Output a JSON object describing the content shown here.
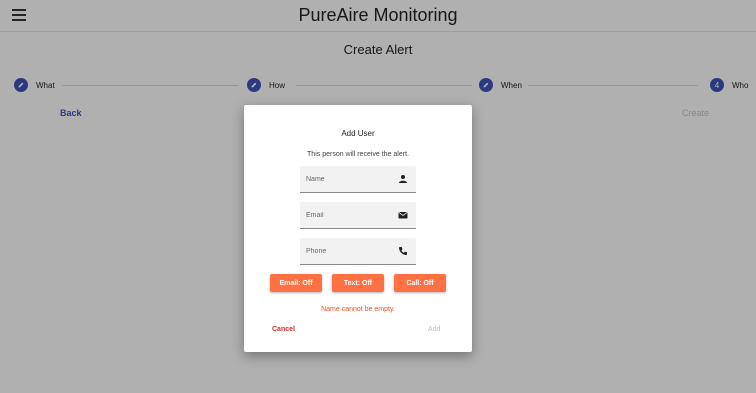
{
  "header": {
    "title": "PureAire Monitoring"
  },
  "page": {
    "title": "Create Alert"
  },
  "stepper": {
    "steps": [
      {
        "label": "What",
        "state": "done"
      },
      {
        "label": "How",
        "state": "done"
      },
      {
        "label": "When",
        "state": "done"
      },
      {
        "label": "Who",
        "state": "active",
        "number": "4"
      }
    ]
  },
  "nav": {
    "back_label": "Back",
    "create_label": "Create"
  },
  "dialog": {
    "title": "Add User",
    "subtitle": "This person will receive the alert.",
    "fields": {
      "name": {
        "placeholder": "Name",
        "value": "",
        "icon": "person-icon"
      },
      "email": {
        "placeholder": "Email",
        "value": "",
        "icon": "mail-icon"
      },
      "phone": {
        "placeholder": "Phone",
        "value": "",
        "icon": "phone-icon"
      }
    },
    "toggles": {
      "email": "Email: Off",
      "text": "Text: Off",
      "call": "Call: Off"
    },
    "error": "Name cannot be empty.",
    "cancel_label": "Cancel",
    "add_label": "Add"
  },
  "colors": {
    "primary": "#3f51b5",
    "accent": "#ff7043",
    "error": "#f4511e",
    "cancel": "#d32f2f"
  }
}
